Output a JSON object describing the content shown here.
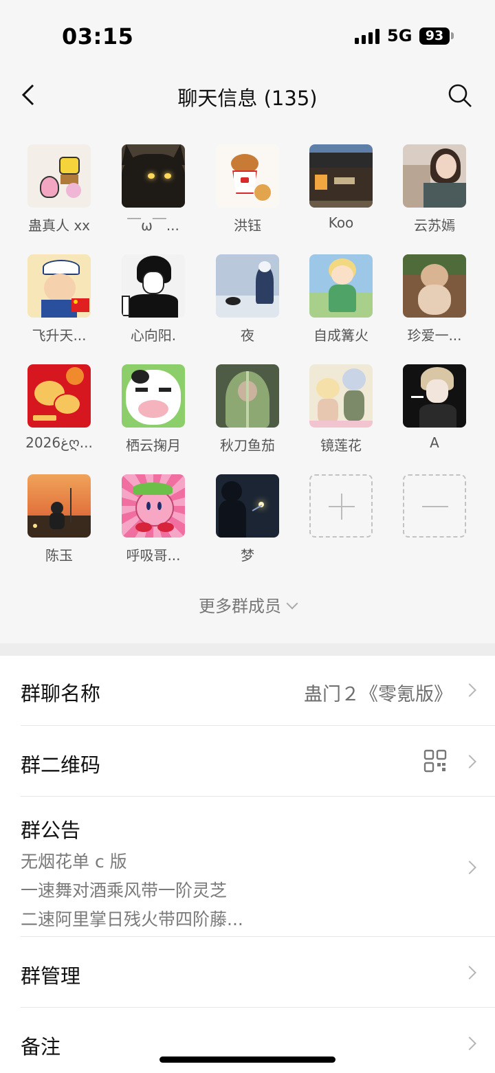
{
  "status": {
    "time": "03:15",
    "network": "5G",
    "battery": "93"
  },
  "nav": {
    "title": "聊天信息 (135)"
  },
  "members": [
    {
      "name": "蛊真人 xx",
      "icon": "cartoon-sponge-avatar"
    },
    {
      "name": "￣ω￣...",
      "icon": "black-cat-avatar"
    },
    {
      "name": "洪钰",
      "icon": "fried-chicken-bucket-avatar"
    },
    {
      "name": "Koo",
      "icon": "storefront-avatar"
    },
    {
      "name": "云苏嫣",
      "icon": "girl-photo-avatar"
    },
    {
      "name": "飞升天...",
      "icon": "sailor-boy-avatar"
    },
    {
      "name": "心向阳.",
      "icon": "manga-boy-avatar"
    },
    {
      "name": "夜",
      "icon": "snow-figure-avatar"
    },
    {
      "name": "自成篝火",
      "icon": "anime-kid-avatar"
    },
    {
      "name": "珍爱一...",
      "icon": "hamster-avatar"
    },
    {
      "name": "ﻍ2026ღ...",
      "icon": "wechat-new-year-avatar"
    },
    {
      "name": "栖云掬月",
      "icon": "cow-face-avatar"
    },
    {
      "name": "秋刀鱼茄",
      "icon": "leaf-man-avatar"
    },
    {
      "name": "镜莲花",
      "icon": "anime-couple-avatar"
    },
    {
      "name": "A",
      "icon": "anime-boy-dark-avatar"
    },
    {
      "name": "陈玉",
      "icon": "sunset-boy-avatar"
    },
    {
      "name": "呼吸哥...",
      "icon": "kirby-avatar"
    },
    {
      "name": "梦",
      "icon": "sparkler-avatar"
    }
  ],
  "more_members_label": "更多群成员",
  "settings": {
    "group_name_label": "群聊名称",
    "group_name_value": "蛊门２《零氪版》",
    "qr_label": "群二维码",
    "notice_label": "群公告",
    "notice_lines": [
      "无烟花单 c 版",
      "一速舞对酒乘风带一阶灵芝",
      "二速阿里掌日残火带四阶藤..."
    ],
    "manage_label": "群管理",
    "remark_label": "备注"
  }
}
